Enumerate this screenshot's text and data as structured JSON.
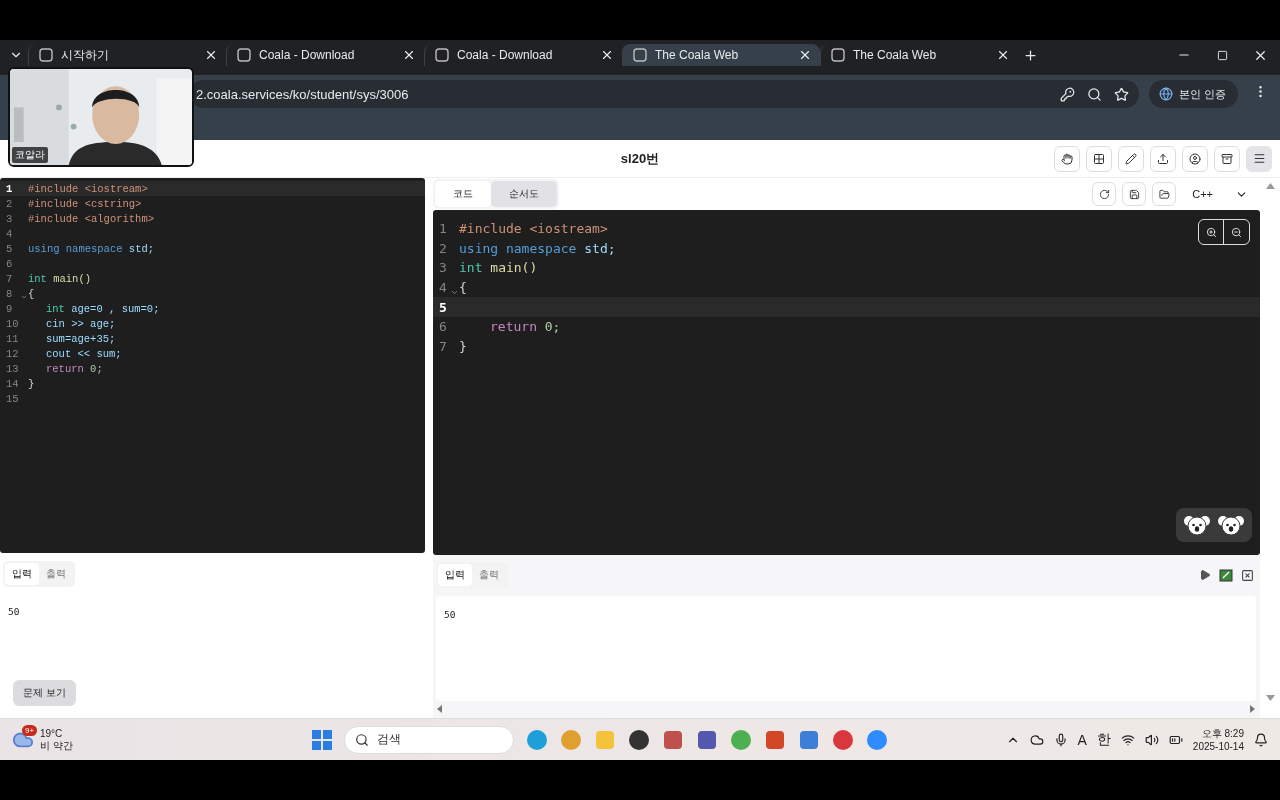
{
  "browser": {
    "tabs": [
      {
        "title": "시작하기",
        "selected": false
      },
      {
        "title": "Coala - Download",
        "selected": false
      },
      {
        "title": "Coala - Download",
        "selected": false
      },
      {
        "title": "The Coala Web",
        "selected": true
      },
      {
        "title": "The Coala Web",
        "selected": false
      }
    ],
    "address": "2.coala.services/ko/student/sys/3006",
    "verify_button": "본인 인증"
  },
  "webcam": {
    "kind": "picture",
    "caption": "코알라"
  },
  "header": {
    "title": "sl20번"
  },
  "reference_editor": {
    "lines": [
      {
        "number": "1",
        "active": true,
        "foldable": false,
        "indented": false,
        "tokens": [
          {
            "kind": "pre",
            "text": "#include <iostream>"
          }
        ]
      },
      {
        "number": "2",
        "active": false,
        "foldable": false,
        "indented": false,
        "tokens": [
          {
            "kind": "pre",
            "text": "#include <cstring>"
          }
        ]
      },
      {
        "number": "3",
        "active": false,
        "foldable": false,
        "indented": false,
        "tokens": [
          {
            "kind": "pre",
            "text": "#include <algorithm>"
          }
        ]
      },
      {
        "number": "4",
        "active": false,
        "foldable": false
      },
      {
        "number": "5",
        "active": false,
        "foldable": false,
        "indented": false,
        "tokens": [
          {
            "kind": "kw",
            "text": "using namespace "
          },
          {
            "kind": "var",
            "text": "std;"
          }
        ]
      },
      {
        "number": "6",
        "active": false,
        "foldable": false
      },
      {
        "number": "7",
        "active": false,
        "foldable": false,
        "indented": false,
        "tokens": [
          {
            "kind": "type",
            "text": "int "
          },
          {
            "kind": "fn",
            "text": "main()"
          }
        ]
      },
      {
        "number": "8",
        "active": false,
        "foldable": true,
        "indented": false,
        "tokens": [
          {
            "kind": "plain",
            "text": "{"
          }
        ]
      },
      {
        "number": "9",
        "active": false,
        "foldable": false,
        "indented": true,
        "tokens": [
          {
            "kind": "type",
            "text": "int "
          },
          {
            "kind": "var",
            "text": "age=0 , sum=0;"
          }
        ]
      },
      {
        "number": "10",
        "active": false,
        "foldable": false,
        "indented": true,
        "tokens": [
          {
            "kind": "var",
            "text": "cin >> age;"
          }
        ]
      },
      {
        "number": "11",
        "active": false,
        "foldable": false,
        "indented": true,
        "tokens": [
          {
            "kind": "var",
            "text": "sum=age+35;"
          }
        ]
      },
      {
        "number": "12",
        "active": false,
        "foldable": false,
        "indented": true,
        "tokens": [
          {
            "kind": "var",
            "text": "cout << sum;"
          }
        ]
      },
      {
        "number": "13",
        "active": false,
        "foldable": false,
        "indented": true,
        "tokens": [
          {
            "kind": "ret",
            "text": "return "
          },
          {
            "kind": "num",
            "text": "0;"
          }
        ]
      },
      {
        "number": "14",
        "active": false,
        "foldable": false,
        "indented": false,
        "tokens": [
          {
            "kind": "plain",
            "text": "}"
          }
        ]
      },
      {
        "number": "15",
        "active": false,
        "foldable": false
      }
    ]
  },
  "reference_io": {
    "tabs": [
      {
        "label": "입력",
        "selected": true
      },
      {
        "label": "출력",
        "selected": false
      }
    ],
    "content": "50",
    "problem_button": "문제 보기"
  },
  "workspace": {
    "view_tabs": [
      {
        "label": "코드",
        "selected": true
      },
      {
        "label": "순서도",
        "selected": false
      }
    ],
    "language": "C++",
    "lines": [
      {
        "number": "1",
        "active": false,
        "foldable": false,
        "indented": false,
        "tokens": [
          {
            "kind": "pre",
            "text": "#include <iostream>"
          }
        ]
      },
      {
        "number": "2",
        "active": false,
        "foldable": false,
        "indented": false,
        "tokens": [
          {
            "kind": "kw",
            "text": "using namespace "
          },
          {
            "kind": "var",
            "text": "std;"
          }
        ]
      },
      {
        "number": "3",
        "active": false,
        "foldable": false,
        "indented": false,
        "tokens": [
          {
            "kind": "type",
            "text": "int "
          },
          {
            "kind": "fn",
            "text": "main()"
          }
        ]
      },
      {
        "number": "4",
        "active": false,
        "foldable": true,
        "indented": false,
        "tokens": [
          {
            "kind": "plain",
            "text": "{"
          }
        ]
      },
      {
        "number": "5",
        "active": true,
        "foldable": false
      },
      {
        "number": "6",
        "active": false,
        "foldable": false,
        "indented": true,
        "tokens": [
          {
            "kind": "ret",
            "text": "return "
          },
          {
            "kind": "num",
            "text": "0;"
          }
        ]
      },
      {
        "number": "7",
        "active": false,
        "foldable": false,
        "indented": false,
        "tokens": [
          {
            "kind": "plain",
            "text": "}"
          }
        ]
      }
    ]
  },
  "io": {
    "tabs": [
      {
        "label": "입력",
        "selected": true
      },
      {
        "label": "출력",
        "selected": false
      }
    ],
    "input": "50"
  },
  "taskbar": {
    "weather_badge": "9+",
    "temperature": "19°C",
    "weather": "비 약간",
    "search": "검색",
    "ime_mode": "A",
    "ime_lang": "한",
    "time": "오후 8:29",
    "date": "2025-10-14"
  }
}
